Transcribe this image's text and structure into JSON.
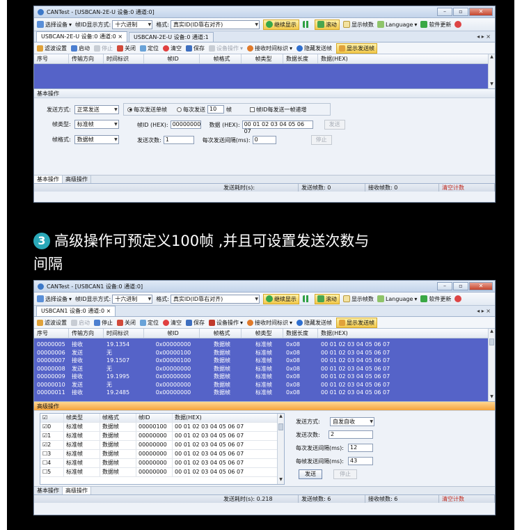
{
  "colors": {
    "grid_bg": "#5563c8",
    "orange_header": "#f5a43c",
    "badge": "#2aa8b8"
  },
  "caption": {
    "badge": "3",
    "line1": "高级操作可预定义100帧 ,并且可设置发送次数与",
    "line2": "间隔"
  },
  "window1": {
    "title": "CANTest - [USBCAN-2E-U 设备:0 通道:0]",
    "toolbar": {
      "select_device": "选择设备",
      "id_display_label": "帧ID显示方式:",
      "id_display_value": "十六进制",
      "format_label": "格式:",
      "format_value": "真实ID(ID靠右对齐)",
      "continue_display": "继续显示",
      "scroll": "滚动",
      "show_frames": "显示帧数",
      "language": "Language",
      "update": "软件更新"
    },
    "tabs": [
      "USBCAN-2E-U 设备:0 通道:0",
      "USBCAN-2E-U 设备:0 通道:1"
    ],
    "tab_close": "×",
    "tab_arrows": "◂ ▸ ×",
    "toolbar2": [
      "滤波设置",
      "启动",
      "停止",
      "关闭",
      "定位",
      "清空",
      "保存",
      "设备操作",
      "接收时间标识",
      "隐藏发送帧",
      "显示发送帧"
    ],
    "columns": [
      "序号",
      "传输方向",
      "时间标识",
      "帧ID",
      "帧格式",
      "帧类型",
      "数据长度",
      "数据(HEX)"
    ],
    "basic": {
      "title": "基本操作",
      "send_mode_label": "发送方式:",
      "send_mode_value": "正常发送",
      "radio_single": "每次发送单帧",
      "radio_multi": "每次发送",
      "multi_count": "10",
      "multi_unit": "帧",
      "increment_label": "帧ID每发送一帧递增",
      "frame_type_label": "帧类型:",
      "frame_type_value": "标准帧",
      "frame_id_label": "帧ID (HEX):",
      "frame_id_value": "00000000",
      "data_label": "数据 (HEX):",
      "data_value": "00 01 02 03 04 05 06 07",
      "send_button": "发送",
      "frame_format_label": "帧格式:",
      "frame_format_value": "数据帧",
      "send_times_label": "发送次数:",
      "send_times_value": "1",
      "interval_label": "每次发送间隔(ms):",
      "interval_value": "0",
      "stop_button": "停止"
    },
    "bottom_tabs": [
      "基本操作",
      "高级操作"
    ],
    "status": {
      "send_time": "发送耗时(s):",
      "send_frames": "发送帧数: 0",
      "recv_frames": "接收帧数: 0",
      "clear": "清空计数"
    }
  },
  "window2": {
    "title": "CANTest - [USBCAN1 设备:0 通道:0]",
    "toolbar": {
      "select_device": "选择设备",
      "id_display_label": "帧ID显示方式:",
      "id_display_value": "十六进制",
      "format_label": "格式:",
      "format_value": "真实ID(ID靠右对齐)",
      "continue_display": "继续显示",
      "scroll": "滚动",
      "show_frames": "显示帧数",
      "language": "Language",
      "update": "软件更新"
    },
    "tabs": [
      "USBCAN1 设备:0 通道:0"
    ],
    "tab_close": "×",
    "tab_arrows": "◂ ▸ ×",
    "toolbar2": [
      "滤波设置",
      "启动",
      "停止",
      "关闭",
      "定位",
      "清空",
      "保存",
      "设备操作",
      "接收时间标识",
      "隐藏发送帧",
      "显示发送帧"
    ],
    "columns": [
      "序号",
      "传输方向",
      "时间标识",
      "帧ID",
      "帧格式",
      "帧类型",
      "数据长度",
      "数据(HEX)"
    ],
    "rows": [
      [
        "00000005",
        "接收",
        "19.1354",
        "0x00000000",
        "数据帧",
        "标准帧",
        "0x08",
        "00 01 02 03 04 05 06 07"
      ],
      [
        "00000006",
        "发送",
        "无",
        "0x00000100",
        "数据帧",
        "标准帧",
        "0x08",
        "00 01 02 03 04 05 06 07"
      ],
      [
        "00000007",
        "接收",
        "19.1507",
        "0x00000100",
        "数据帧",
        "标准帧",
        "0x08",
        "00 01 02 03 04 05 06 07"
      ],
      [
        "00000008",
        "发送",
        "无",
        "0x00000000",
        "数据帧",
        "标准帧",
        "0x08",
        "00 01 02 03 04 05 06 07"
      ],
      [
        "00000009",
        "接收",
        "19.1995",
        "0x00000000",
        "数据帧",
        "标准帧",
        "0x08",
        "00 01 02 03 04 05 06 07"
      ],
      [
        "00000010",
        "发送",
        "无",
        "0x00000000",
        "数据帧",
        "标准帧",
        "0x08",
        "00 01 02 03 04 05 06 07"
      ],
      [
        "00000011",
        "接收",
        "19.2485",
        "0x00000000",
        "数据帧",
        "标准帧",
        "0x08",
        "00 01 02 03 04 05 06 07"
      ]
    ],
    "advanced": {
      "title": "高级操作",
      "table_columns": [
        "帧类型",
        "帧格式",
        "帧ID",
        "数据(HEX)"
      ],
      "table_rows": [
        {
          "check": "☑",
          "index": "0",
          "type": "标准帧",
          "format": "数据帧",
          "id": "00000100",
          "data": "00 01 02 03 04 05 06 07"
        },
        {
          "check": "☑",
          "index": "1",
          "type": "标准帧",
          "format": "数据帧",
          "id": "00000000",
          "data": "00 01 02 03 04 05 06 07"
        },
        {
          "check": "☑",
          "index": "2",
          "type": "标准帧",
          "format": "数据帧",
          "id": "00000000",
          "data": "00 01 02 03 04 05 06 07"
        },
        {
          "check": "☐",
          "index": "3",
          "type": "标准帧",
          "format": "数据帧",
          "id": "00000000",
          "data": "00 01 02 03 04 05 06 07"
        },
        {
          "check": "☐",
          "index": "4",
          "type": "标准帧",
          "format": "数据帧",
          "id": "00000000",
          "data": "00 01 02 03 04 05 06 07"
        },
        {
          "check": "☐",
          "index": "5",
          "type": "标准帧",
          "format": "数据帧",
          "id": "00000000",
          "data": "00 01 02 03 04 05 06 07"
        }
      ],
      "send_mode_label": "发送方式:",
      "send_mode_value": "自发自收",
      "send_times_label": "发送次数:",
      "send_times_value": "2",
      "interval_label": "每次发送间隔(ms):",
      "interval_value": "12",
      "frame_interval_label": "每帧发送间隔(ms):",
      "frame_interval_value": "43",
      "send_button": "发送",
      "stop_button": "停止"
    },
    "bottom_tabs": [
      "基本操作",
      "高级操作"
    ],
    "status": {
      "send_time": "发送耗时(s): 0.218",
      "send_frames": "发送帧数: 6",
      "recv_frames": "接收帧数: 6",
      "clear": "清空计数"
    }
  }
}
